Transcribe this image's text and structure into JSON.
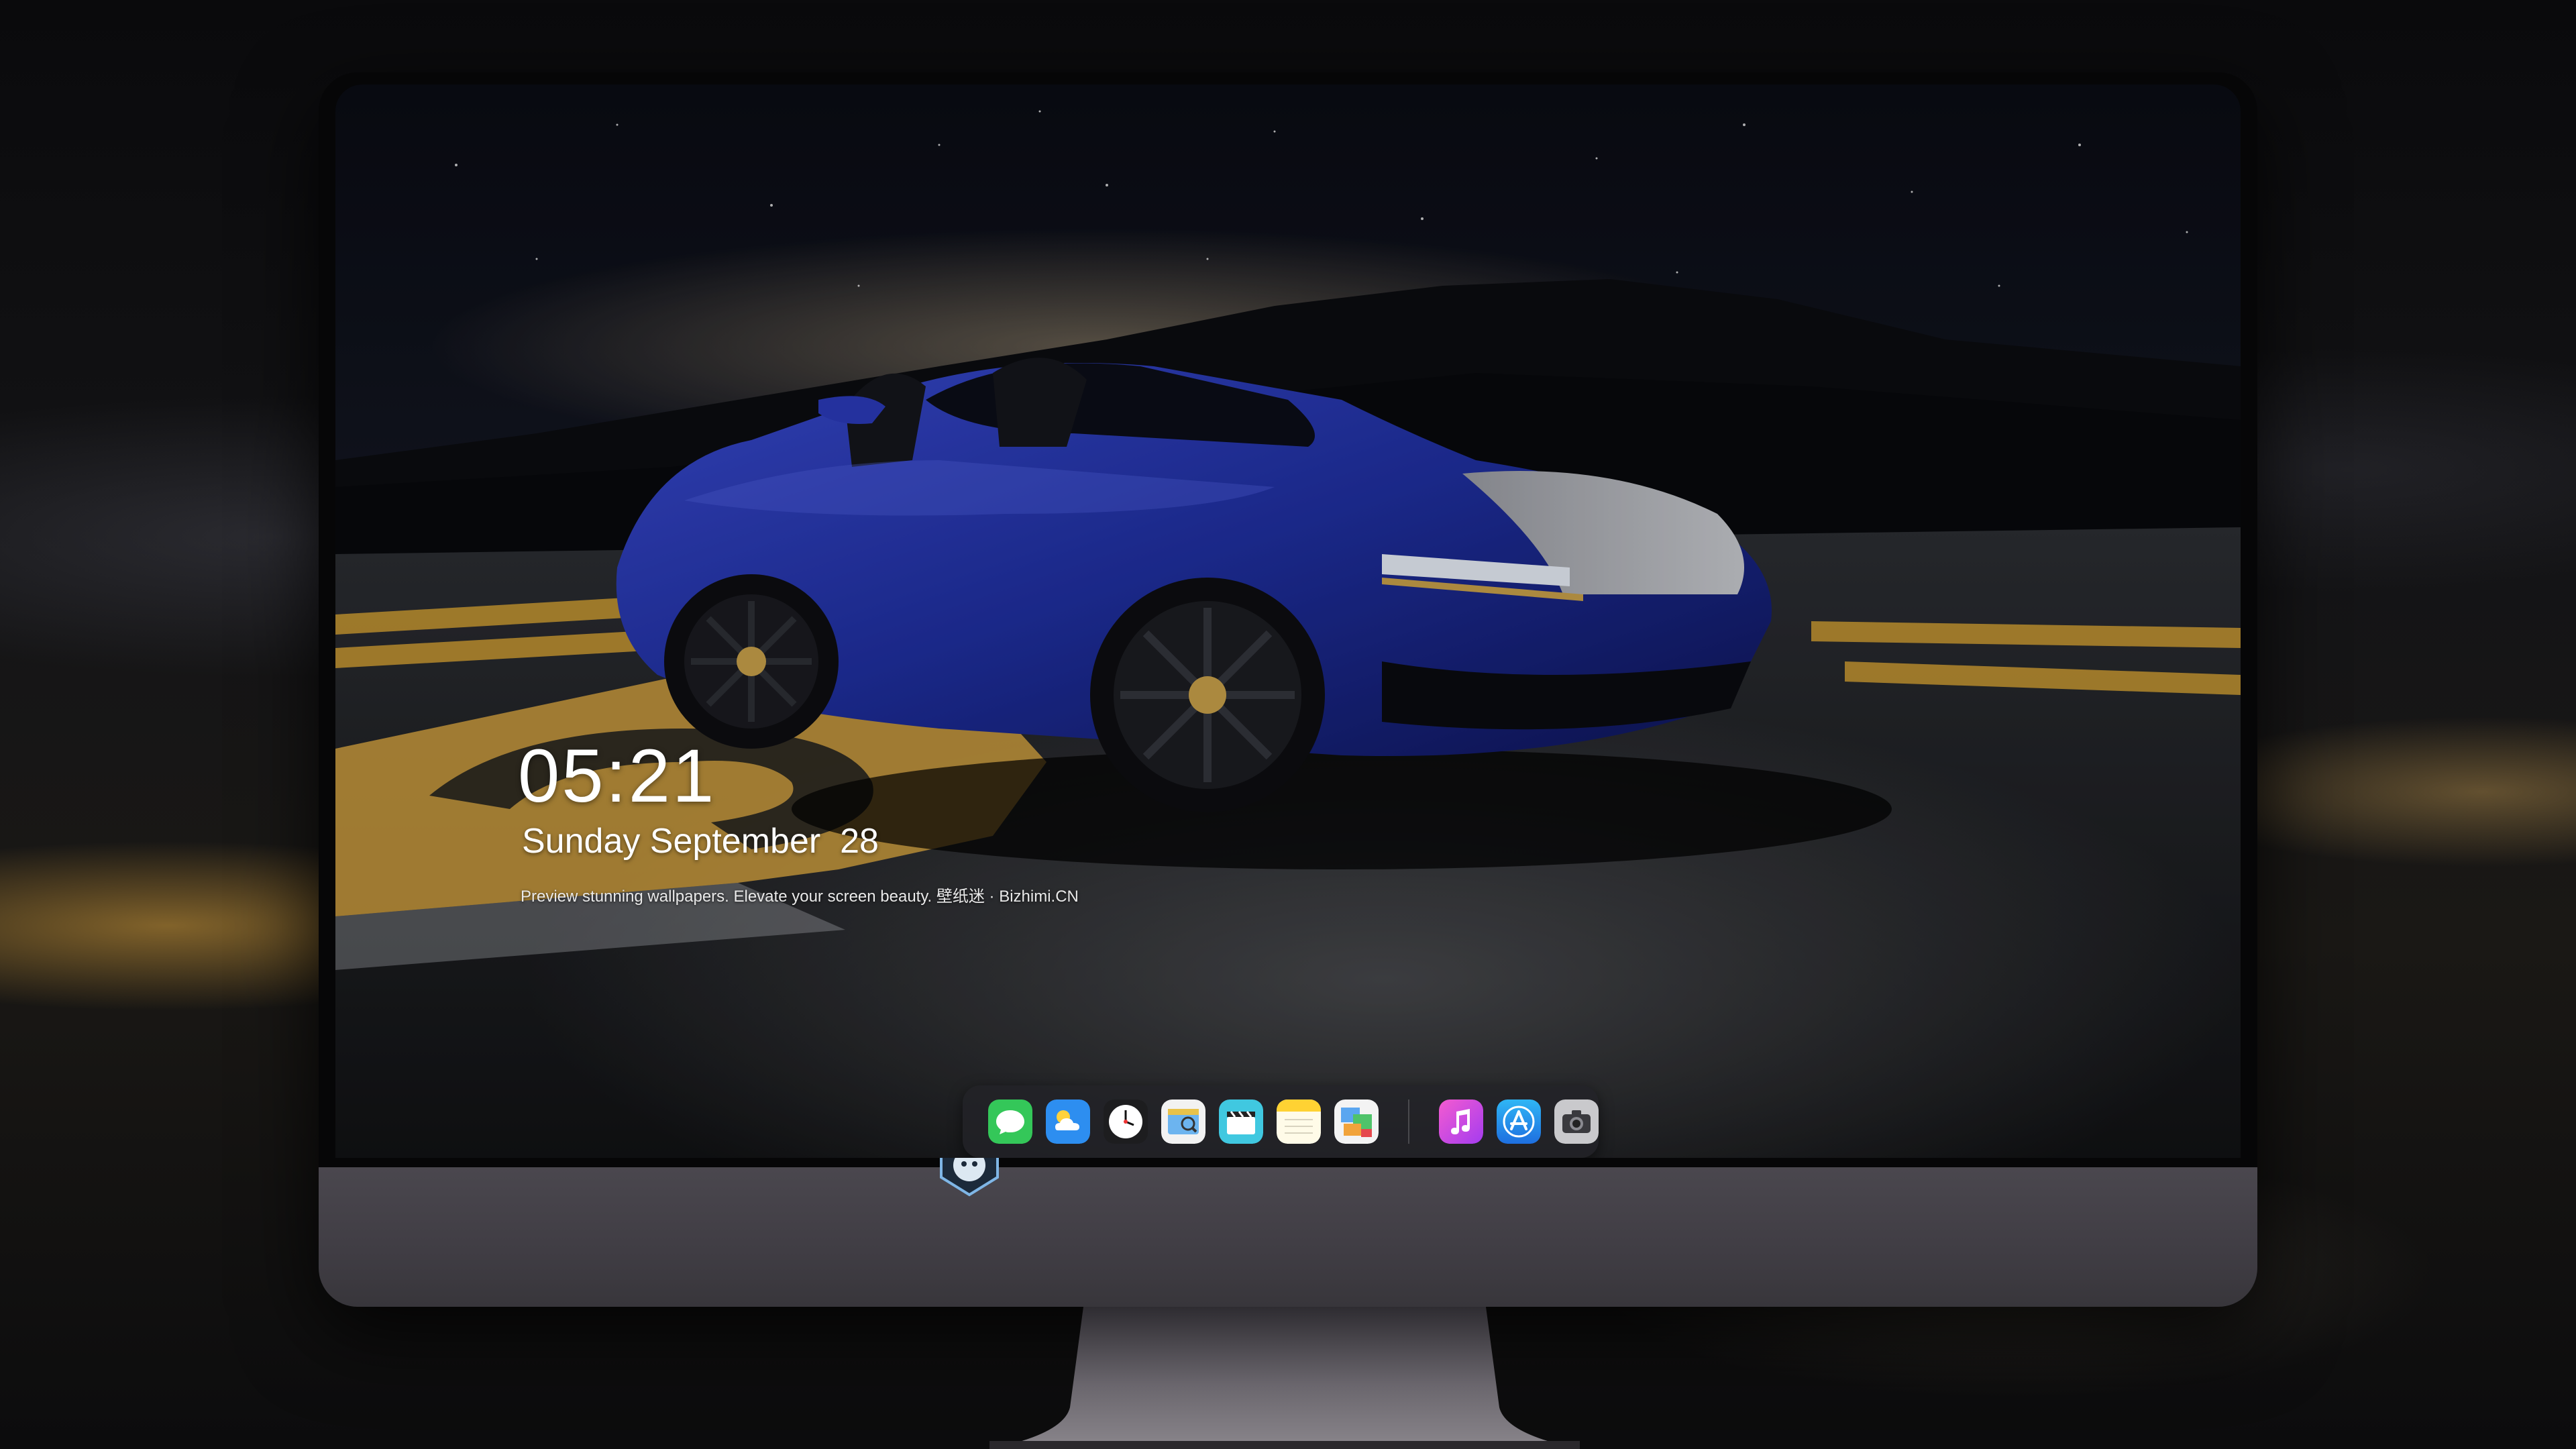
{
  "lockscreen": {
    "time": "05:21",
    "date": "Sunday September  28",
    "tagline": "Preview stunning wallpapers. Elevate your screen beauty. 壁纸迷 · Bizhimi.CN"
  },
  "dock": {
    "apps": [
      {
        "name": "messages-icon"
      },
      {
        "name": "weather-icon"
      },
      {
        "name": "clock-icon"
      },
      {
        "name": "preview-icon"
      },
      {
        "name": "clapperboard-icon"
      },
      {
        "name": "notes-icon"
      },
      {
        "name": "photo-gallery-icon"
      },
      {
        "name": "music-icon"
      },
      {
        "name": "app-store-icon"
      },
      {
        "name": "camera-icon"
      }
    ]
  },
  "colors": {
    "chin": "#403d44",
    "car_body": "#1f2fa0",
    "runway_marking": "#c99a33"
  }
}
